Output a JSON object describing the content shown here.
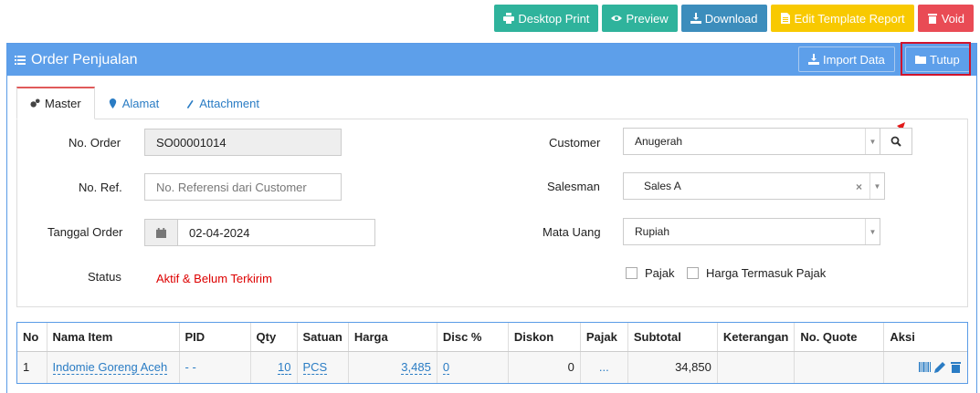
{
  "toolbar": {
    "desktop_print": "Desktop Print",
    "preview": "Preview",
    "download": "Download",
    "edit_template": "Edit Template Report",
    "void": "Void"
  },
  "panel": {
    "title": "Order Penjualan",
    "import": "Import Data",
    "tutup": "Tutup"
  },
  "tabs": [
    "Master",
    "Alamat",
    "Attachment"
  ],
  "form": {
    "no_order_label": "No. Order",
    "no_order_value": "SO00001014",
    "no_ref_label": "No. Ref.",
    "no_ref_placeholder": "No. Referensi dari Customer",
    "tanggal_label": "Tanggal Order",
    "tanggal_value": "02-04-2024",
    "status_label": "Status",
    "status_value": "Aktif & Belum Terkirim",
    "customer_label": "Customer",
    "customer_value": "Anugerah",
    "salesman_label": "Salesman",
    "salesman_value": "Sales A",
    "mata_uang_label": "Mata Uang",
    "mata_uang_value": "Rupiah",
    "pajak_label": "Pajak",
    "harga_pajak_label": "Harga Termasuk Pajak"
  },
  "table": {
    "headers": [
      "No",
      "Nama Item",
      "PID",
      "Qty",
      "Satuan",
      "Harga",
      "Disc %",
      "Diskon",
      "Pajak",
      "Subtotal",
      "Keterangan",
      "No. Quote",
      "Aksi"
    ],
    "rows": [
      {
        "no": "1",
        "nama_item": "Indomie Goreng Aceh",
        "pid": "- -",
        "qty": "10",
        "satuan": "PCS",
        "harga": "3,485",
        "disc": "0",
        "diskon": "0",
        "pajak": "...",
        "subtotal": "34,850",
        "keterangan": "",
        "no_quote": ""
      }
    ]
  }
}
